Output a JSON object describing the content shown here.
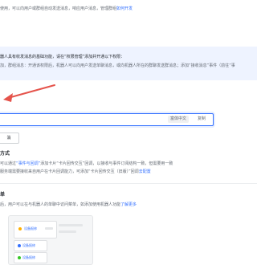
{
  "top": {
    "line1_prefix": "使用，可以向用户或群组自动发送消息，响应用户消息，管理群组",
    "line1_link": "如何开发"
  },
  "notice": {
    "line1": "器人具有收发消息的基础功能，请在“权限管理”添加并开通以下权限：",
    "line2": "加，群组消息：开通该权限后，机器人可以向用户发送单聊消息，或向机器人所在的群聊发送群消息；添加“接收消息”事件（前往“事"
  },
  "input": {
    "value": "",
    "btn_text": "富体中文",
    "btn_copy": "复制"
  },
  "small_button": {
    "label": "消"
  },
  "section2": {
    "title": "方式",
    "line1_prefix": "可以通过",
    "line1_link": "“事件与回调”",
    "line1_suffix": "添加卡片“卡片回传交互”回调，以接收与事件订阅结构一致，但需要用一致",
    "line2_prefix": "服务端需要接收来自用户在卡片回调能力，可添加“卡片回传交互（旧版）”回调",
    "line2_link": "去配置"
  },
  "section3": {
    "title": "单",
    "desc_prefix": "后，用户可以在与机器人的单聊中访问菜单，如添加使用机器人功能",
    "desc_link": "了解更多"
  },
  "preview": {
    "item1": "设备报修",
    "item2": "设备报修",
    "item3": "设备报修"
  },
  "colors": {
    "accent": "#3370ff",
    "notice_bg": "#eef3ff",
    "arrow": "#e5534b"
  }
}
